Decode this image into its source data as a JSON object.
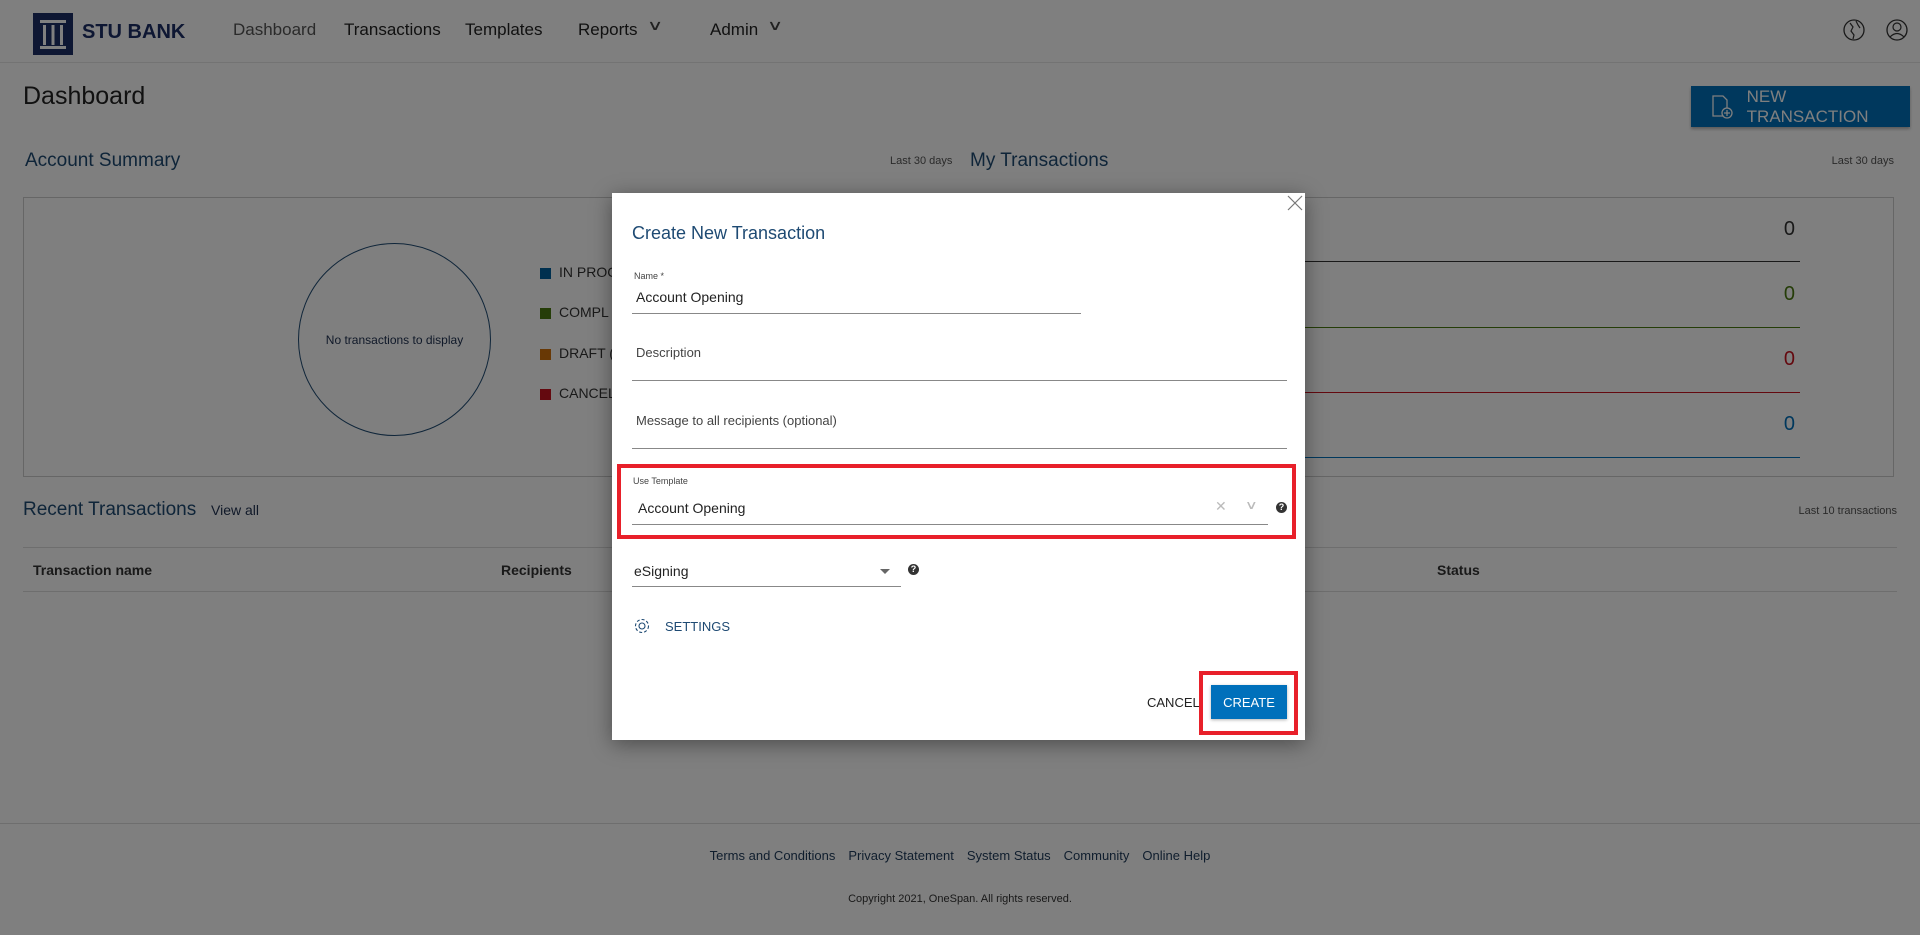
{
  "header": {
    "brand": "STU BANK",
    "nav": [
      {
        "label": "Dashboard"
      },
      {
        "label": "Transactions"
      },
      {
        "label": "Templates"
      },
      {
        "label": "Reports"
      },
      {
        "label": "Admin"
      }
    ]
  },
  "page": {
    "title": "Dashboard",
    "new_transaction_label": "NEW TRANSACTION"
  },
  "account_summary": {
    "title": "Account Summary",
    "period": "Last 30 days",
    "empty_text": "No transactions to display",
    "legend": [
      {
        "label": "IN PROC",
        "color": "#00609e"
      },
      {
        "label": "COMPL",
        "color": "#4a7a10"
      },
      {
        "label": "DRAFT (",
        "color": "#d0700a"
      },
      {
        "label": "CANCEL",
        "color": "#c8121e"
      }
    ]
  },
  "my_transactions": {
    "title": "My Transactions",
    "period": "Last 30 days",
    "rows": [
      {
        "value": "0",
        "color": "#333333"
      },
      {
        "value": "0",
        "color": "#4a7a10"
      },
      {
        "value": "0",
        "color": "#c8121e"
      },
      {
        "value": "0",
        "color": "#0070bb"
      }
    ]
  },
  "recent": {
    "title": "Recent Transactions",
    "view_all": "View all",
    "caption": "Last 10 transactions",
    "columns": [
      "Transaction name",
      "Recipients",
      "Status"
    ]
  },
  "footer": {
    "links": [
      "Terms and Conditions",
      "Privacy Statement",
      "System Status",
      "Community",
      "Online Help"
    ],
    "copyright": "Copyright 2021, OneSpan. All rights reserved."
  },
  "dialog": {
    "title": "Create New Transaction",
    "name_label": "Name *",
    "name_value": "Account Opening",
    "description_placeholder": "Description",
    "message_placeholder": "Message to all recipients (optional)",
    "template_label": "Use Template",
    "template_value": "Account Opening",
    "type_value": "eSigning",
    "settings_label": "SETTINGS",
    "cancel_label": "CANCEL",
    "create_label": "CREATE",
    "highlight_color": "#e8202a",
    "accent_color": "#0070bb"
  }
}
